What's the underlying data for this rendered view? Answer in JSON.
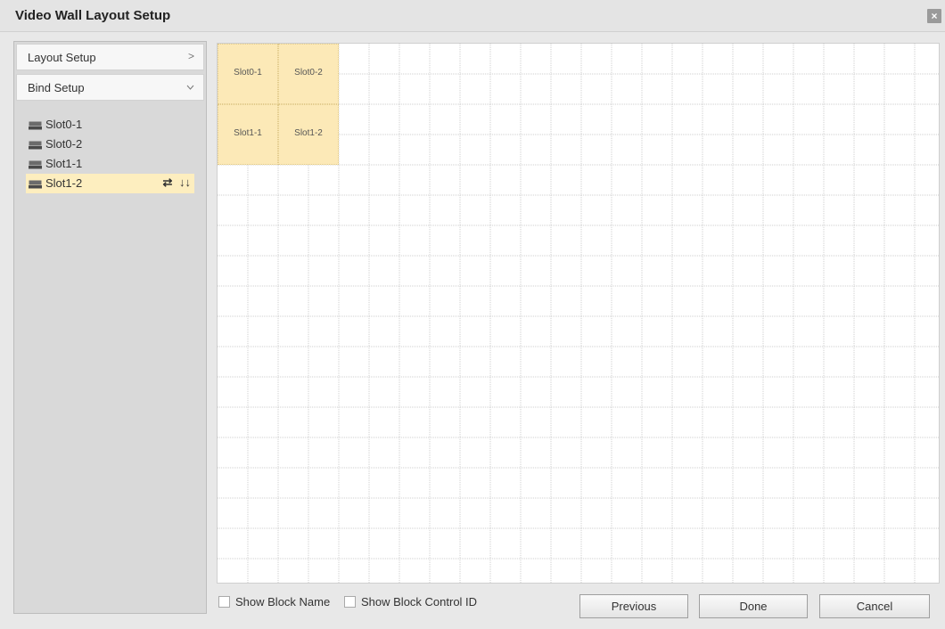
{
  "window": {
    "title": "Video Wall Layout Setup",
    "close_label": "×"
  },
  "sidebar": {
    "menu": [
      {
        "label": "Layout Setup",
        "chevron": ">"
      },
      {
        "label": "Bind Setup",
        "chevron": "v"
      }
    ],
    "slots": [
      {
        "name": "Slot0-1",
        "icon": "monitor-device-icon"
      },
      {
        "name": "Slot0-2",
        "icon": "monitor-device-icon"
      },
      {
        "name": "Slot1-1",
        "icon": "monitor-device-icon"
      },
      {
        "name": "Slot1-2",
        "icon": "monitor-device-icon",
        "selected": true
      }
    ],
    "selected_actions": {
      "swap": "⇄",
      "move_down": "↓↓"
    }
  },
  "grid": {
    "blocks": [
      {
        "label": "Slot0-1"
      },
      {
        "label": "Slot0-2"
      },
      {
        "label": "Slot1-1"
      },
      {
        "label": "Slot1-2"
      }
    ],
    "block_color": "#fce9b7"
  },
  "footer": {
    "show_block_name": "Show Block Name",
    "show_block_control_id": "Show Block Control ID",
    "previous": "Previous",
    "done": "Done",
    "cancel": "Cancel"
  },
  "colors": {
    "selected_row": "#fdeebf",
    "panel": "#d9d9d9",
    "background": "#e8e8e8"
  }
}
